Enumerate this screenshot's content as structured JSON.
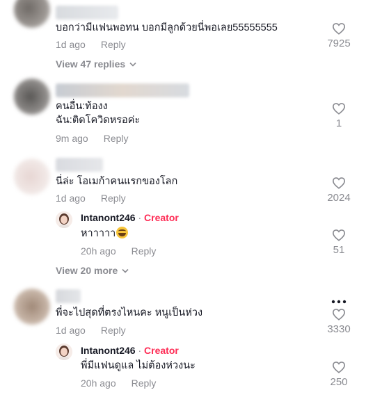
{
  "comments": [
    {
      "lines": [
        "บอกว่ามีแฟนพอทน บอกมีลูกด้วยนี่พอเลย55555555"
      ],
      "time": "1d ago",
      "reply_label": "Reply",
      "likes": "7925",
      "view_replies": "View 47 replies"
    },
    {
      "lines": [
        "คนอื่น:ท้องง",
        "ฉัน:ติดโควิดหรอค่ะ"
      ],
      "time": "9m ago",
      "reply_label": "Reply",
      "likes": "1"
    },
    {
      "lines": [
        "นี่ล่ะ โอเมก้าคนแรกของโลก"
      ],
      "time": "1d ago",
      "reply_label": "Reply",
      "likes": "2024",
      "creator_reply": {
        "username": "Intanont246",
        "separator": " · ",
        "creator_label": "Creator",
        "text": "หาาาาา",
        "emoji": "grinning-squinting-face",
        "time": "20h ago",
        "reply_label": "Reply",
        "likes": "51"
      },
      "view_more": "View 20 more"
    },
    {
      "lines": [
        "พี่จะไปสุดที่ตรงไหนคะ หนูเป็นห่วง"
      ],
      "time": "1d ago",
      "reply_label": "Reply",
      "likes": "3330",
      "creator_reply": {
        "username": "Intanont246",
        "separator": " · ",
        "creator_label": "Creator",
        "text": "พี่มีแฟนดูแล ไม่ต้องห่วงนะ",
        "time": "20h ago",
        "reply_label": "Reply",
        "likes": "250"
      }
    }
  ],
  "icons": {
    "like": "heart-outline-icon",
    "expand": "chevron-down-icon",
    "more": "more-horizontal-icon"
  },
  "colors": {
    "creator_accent": "#fe2c55",
    "secondary_text": "#8a8b91",
    "primary_text": "#161823"
  }
}
